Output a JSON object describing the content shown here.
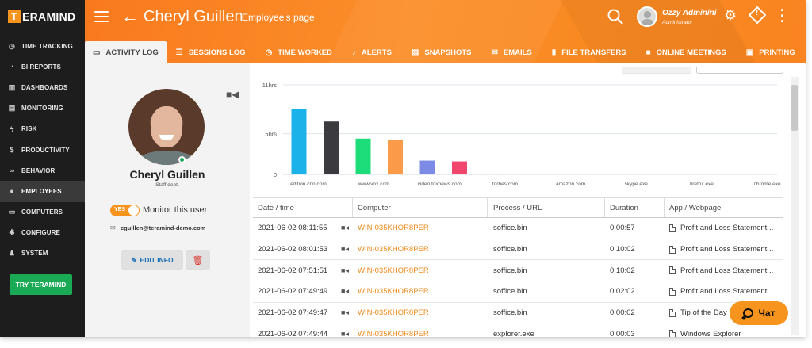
{
  "app": {
    "logo_letter": "T",
    "logo_text": "ERAMIND"
  },
  "sidebar": {
    "items": [
      {
        "label": "TIME TRACKING",
        "icon": "clock-icon"
      },
      {
        "label": "BI REPORTS",
        "icon": "pie-chart-icon"
      },
      {
        "label": "DASHBOARDS",
        "icon": "bar-chart-icon"
      },
      {
        "label": "MONITORING",
        "icon": "monitor-icon"
      },
      {
        "label": "RISK",
        "icon": "bolt-icon"
      },
      {
        "label": "PRODUCTIVITY",
        "icon": "dollar-icon"
      },
      {
        "label": "BEHAVIOR",
        "icon": "binoculars-icon"
      },
      {
        "label": "EMPLOYEES",
        "icon": "user-icon"
      },
      {
        "label": "COMPUTERS",
        "icon": "computer-icon"
      },
      {
        "label": "CONFIGURE",
        "icon": "gear-icon"
      },
      {
        "label": "SYSTEM",
        "icon": "wrench-user-icon"
      }
    ],
    "active_index": 7,
    "try_label": "TRY TERAMIND"
  },
  "header": {
    "title": "Cheryl Guillen",
    "subtitle": "Employee's page",
    "user_name": "Ozzy Adminini",
    "user_role": "Administrator"
  },
  "tabs": [
    {
      "label": "ACTIVITY LOG",
      "icon": "laptop-icon",
      "active": true
    },
    {
      "label": "SESSIONS LOG",
      "icon": "list-icon"
    },
    {
      "label": "TIME WORKED",
      "icon": "clock-icon"
    },
    {
      "label": "ALERTS",
      "icon": "bell-icon"
    },
    {
      "label": "SNAPSHOTS",
      "icon": "image-icon"
    },
    {
      "label": "EMAILS",
      "icon": "envelope-icon"
    },
    {
      "label": "FILE TRANSFERS",
      "icon": "file-icon"
    },
    {
      "label": "ONLINE MEETINGS",
      "icon": "video-icon"
    },
    {
      "label": "PRINTING",
      "icon": "printer-icon"
    }
  ],
  "profile": {
    "name": "Cheryl Guillen",
    "dept": "Staff dept.",
    "toggle_label": "YES",
    "monitor_label": "Monitor this user",
    "email": "cguillen@teramind-demo.com",
    "edit_label": "EDIT INFO"
  },
  "chart_data": {
    "type": "bar",
    "categories": [
      "edition.cnn.com",
      "www.vox.com",
      "video.foxnews.com",
      "forbes.com",
      "amazon.com",
      "skype.exe",
      "firefox.exe",
      "chrome.exe"
    ],
    "tick_labels": [
      "11hrs",
      "5hrs",
      "0"
    ],
    "ylim": [
      0,
      11
    ],
    "bars": [
      {
        "value": 8.0,
        "color": "#1ab2e8"
      },
      {
        "value": 6.5,
        "color": "#3b3b3f"
      },
      {
        "value": 4.4,
        "color": "#1ddd7a"
      },
      {
        "value": 4.2,
        "color": "#fb9a48"
      },
      {
        "value": 1.7,
        "color": "#7b8be6"
      },
      {
        "value": 1.6,
        "color": "#f2466e"
      },
      {
        "value": 0.1,
        "color": "#d4cf5a"
      }
    ]
  },
  "table": {
    "headers": [
      "Date / time",
      "Computer",
      "Process / URL",
      "Duration",
      "App / Webpage"
    ],
    "rows": [
      {
        "date": "2021-06-02 08:11:55",
        "computer": "WIN-035KHOR8PER",
        "process": "soffice.bin",
        "duration": "0:00:57",
        "app": "Profit and Loss Statement..."
      },
      {
        "date": "2021-06-02 08:01:53",
        "computer": "WIN-035KHOR8PER",
        "process": "soffice.bin",
        "duration": "0:10:02",
        "app": "Profit and Loss Statement..."
      },
      {
        "date": "2021-06-02 07:51:51",
        "computer": "WIN-035KHOR8PER",
        "process": "soffice.bin",
        "duration": "0:10:02",
        "app": "Profit and Loss Statement..."
      },
      {
        "date": "2021-06-02 07:49:49",
        "computer": "WIN-035KHOR8PER",
        "process": "soffice.bin",
        "duration": "0:02:02",
        "app": "Profit and Loss Statement..."
      },
      {
        "date": "2021-06-02 07:49:47",
        "computer": "WIN-035KHOR8PER",
        "process": "soffice.bin",
        "duration": "0:00:02",
        "app": "Tip of the Day"
      },
      {
        "date": "2021-06-02 07:49:44",
        "computer": "WIN-035KHOR8PER",
        "process": "explorer.exe",
        "duration": "0:00:03",
        "app": "Windows Explorer"
      }
    ]
  },
  "chat": {
    "label": "Чат"
  }
}
